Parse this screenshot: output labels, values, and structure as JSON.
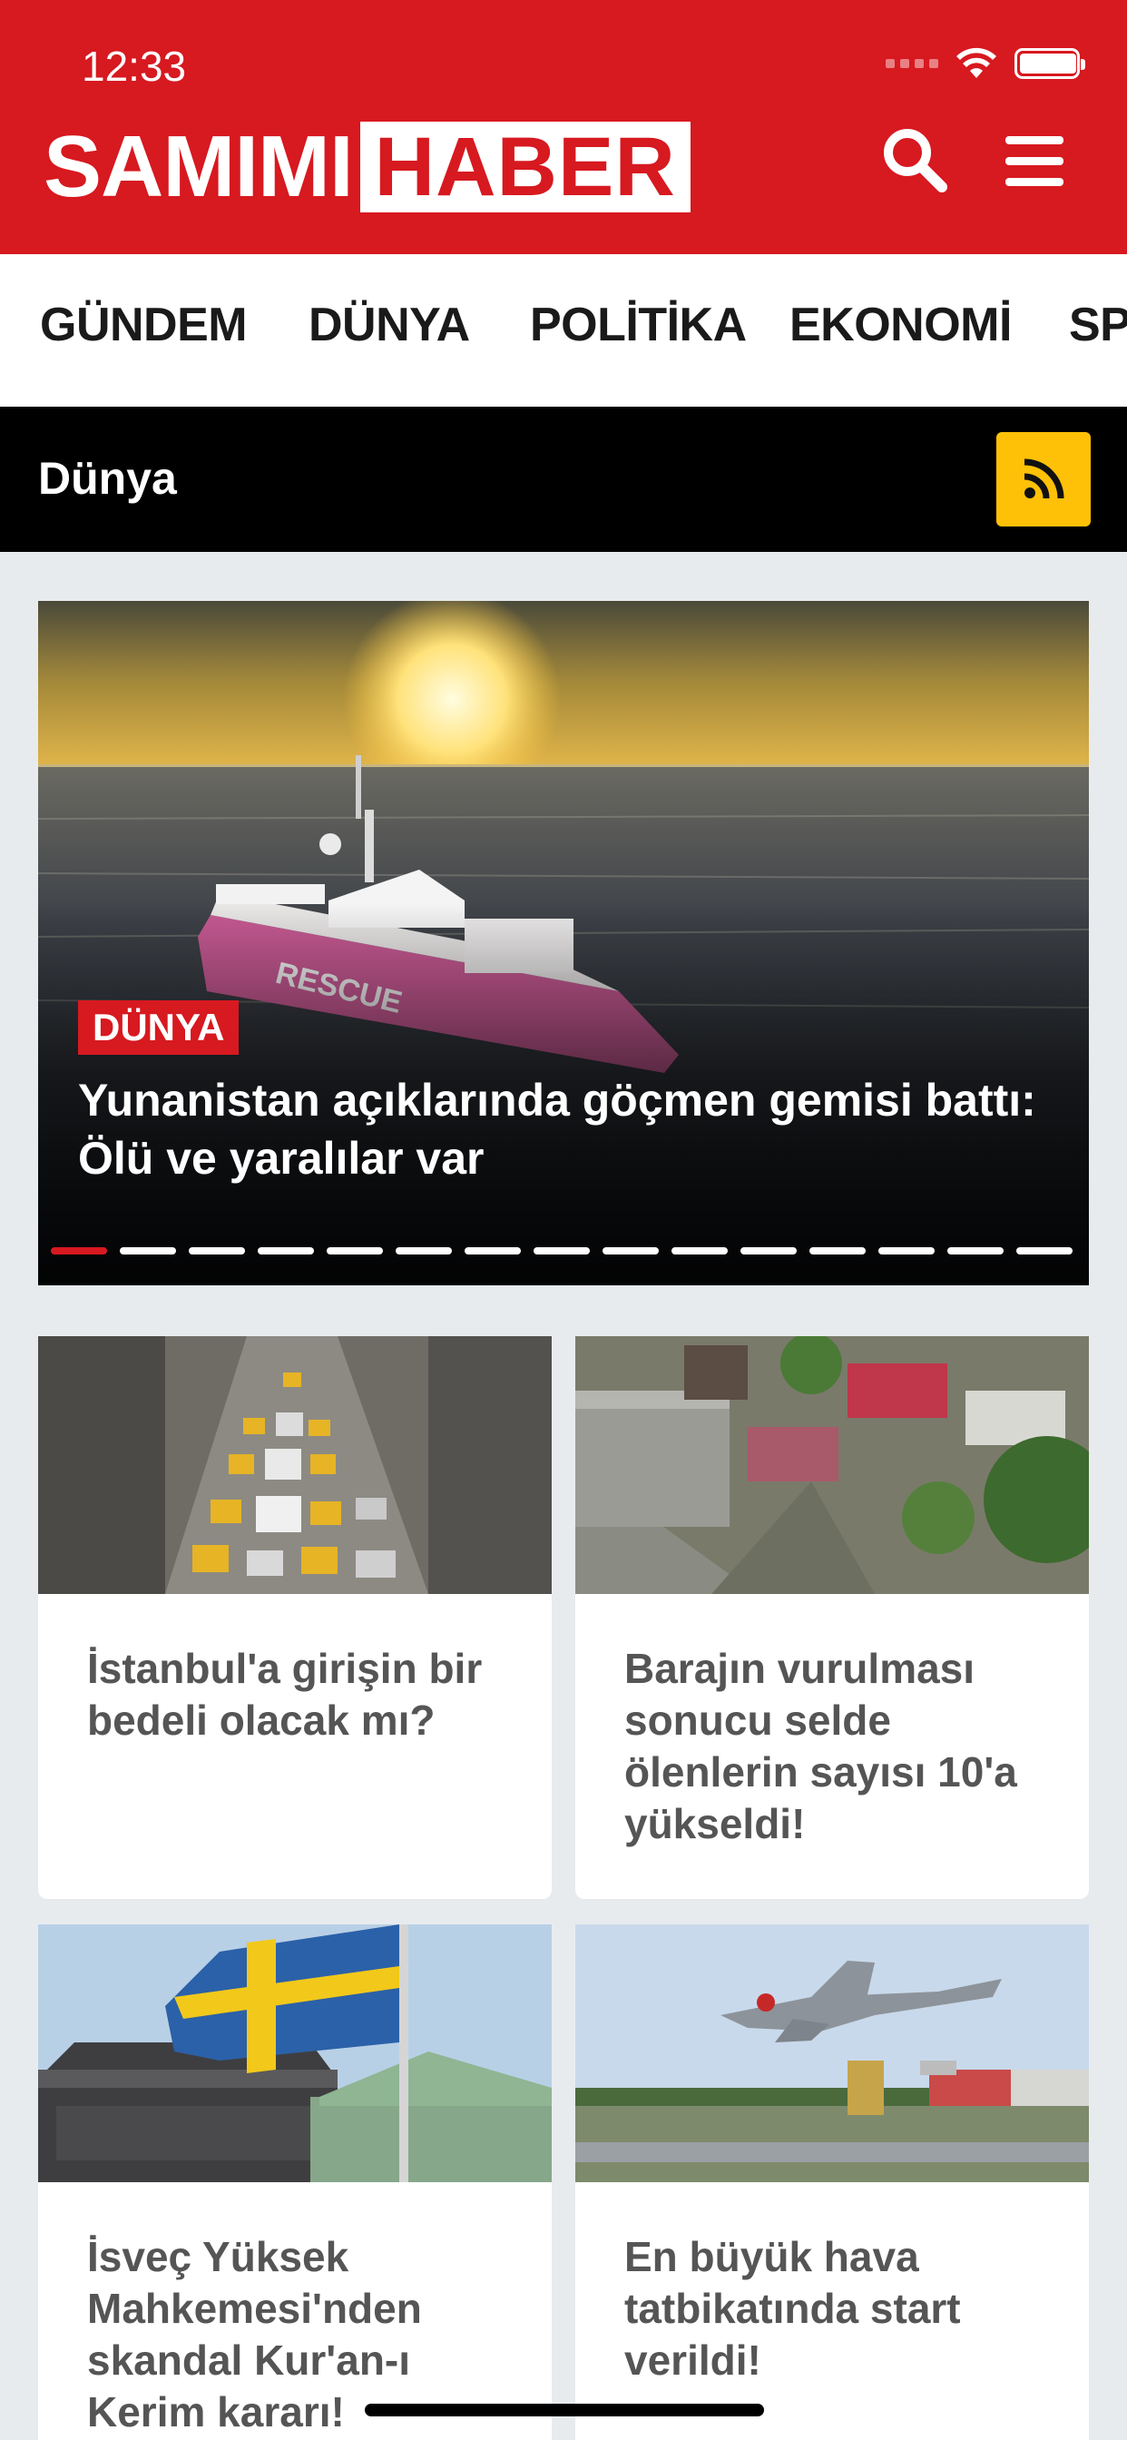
{
  "status_bar": {
    "time": "12:33"
  },
  "header": {
    "logo_part1": "SAMIMI",
    "logo_part2": "HABER",
    "brand_color": "#d71920",
    "search_icon": "search-icon",
    "menu_icon": "hamburger-menu-icon"
  },
  "categories": [
    "GÜNDEM",
    "DÜNYA",
    "POLİTİKA",
    "EKONOMİ",
    "SPOR"
  ],
  "section": {
    "title": "Dünya",
    "rss_icon": "rss-icon",
    "rss_color": "#ffc107"
  },
  "hero": {
    "badge": "DÜNYA",
    "title": "Yunanistan açıklarında göçmen gemisi battı: Ölü ve yaralılar var",
    "slide_count": 15,
    "active_slide": 1
  },
  "articles": [
    {
      "title": "İstanbul'a girişin bir bedeli olacak mı?"
    },
    {
      "title": "Barajın vurulması sonucu selde ölenlerin sayısı 10'a yükseldi!"
    },
    {
      "title": "İsveç Yüksek Mahkemesi'nden skandal Kur'an-ı Kerim kararı!"
    },
    {
      "title": "En büyük hava tatbikatında start verildi!"
    }
  ]
}
